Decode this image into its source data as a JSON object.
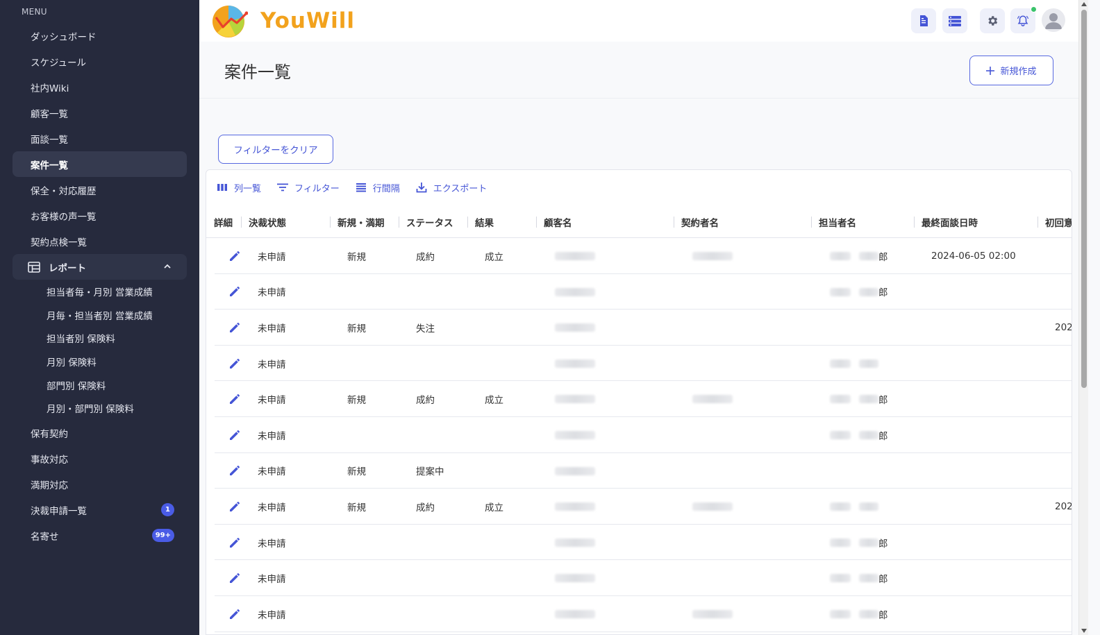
{
  "sidebar": {
    "heading": "MENU",
    "items": [
      {
        "label": "ダッシュボード"
      },
      {
        "label": "スケジュール"
      },
      {
        "label": "社内Wiki"
      },
      {
        "label": "顧客一覧"
      },
      {
        "label": "面談一覧"
      },
      {
        "label": "案件一覧",
        "active": true
      },
      {
        "label": "保全・対応履歴"
      },
      {
        "label": "お客様の声一覧"
      },
      {
        "label": "契約点検一覧"
      }
    ],
    "report_group": {
      "label": "レポート",
      "expanded": true,
      "sub_items": [
        {
          "label": "担当者毎・月別 営業成績"
        },
        {
          "label": "月毎・担当者別 営業成績"
        },
        {
          "label": "担当者別 保険料"
        },
        {
          "label": "月別 保険料"
        },
        {
          "label": "部門別 保険料"
        },
        {
          "label": "月別・部門別 保険料"
        }
      ]
    },
    "items_after": [
      {
        "label": "保有契約"
      },
      {
        "label": "事故対応"
      },
      {
        "label": "満期対応"
      },
      {
        "label": "決裁申請一覧",
        "badge": "1"
      },
      {
        "label": "名寄せ",
        "badge": "99+"
      }
    ]
  },
  "header": {
    "brand": "YouWill",
    "icons": [
      "document-icon",
      "list-icon",
      "gear-icon",
      "bell-icon",
      "user-icon"
    ]
  },
  "page": {
    "title": "案件一覧",
    "new_button": "新規作成",
    "clear_filter": "フィルターをクリア"
  },
  "toolbar": {
    "columns": "列一覧",
    "filter": "フィルター",
    "density": "行間隔",
    "export": "エクスポート"
  },
  "table": {
    "headers": {
      "detail": "詳細",
      "approval": "決裁状態",
      "type": "新規・満期",
      "status": "ステータス",
      "result": "結果",
      "customer": "顧客名",
      "contractor": "契約者名",
      "owner": "担当者名",
      "last_meeting": "最終面談日時",
      "first": "初回意"
    },
    "rows": [
      {
        "approval": "未申請",
        "type": "新規",
        "status": "成約",
        "result": "成立",
        "owner_tail": "郎",
        "last_meeting": "2024-06-05 02:00",
        "first": ""
      },
      {
        "approval": "未申請",
        "type": "",
        "status": "",
        "result": "",
        "owner_tail": "郎",
        "last_meeting": "",
        "first": ""
      },
      {
        "approval": "未申請",
        "type": "新規",
        "status": "失注",
        "result": "",
        "owner_tail": "",
        "last_meeting": "",
        "first": "202"
      },
      {
        "approval": "未申請",
        "type": "",
        "status": "",
        "result": "",
        "owner_tail": "",
        "last_meeting": "",
        "first": ""
      },
      {
        "approval": "未申請",
        "type": "新規",
        "status": "成約",
        "result": "成立",
        "owner_tail": "郎",
        "last_meeting": "",
        "first": ""
      },
      {
        "approval": "未申請",
        "type": "",
        "status": "",
        "result": "",
        "owner_tail": "郎",
        "last_meeting": "",
        "first": ""
      },
      {
        "approval": "未申請",
        "type": "新規",
        "status": "提案中",
        "result": "",
        "owner_tail": "",
        "last_meeting": "",
        "first": ""
      },
      {
        "approval": "未申請",
        "type": "新規",
        "status": "成約",
        "result": "成立",
        "owner_tail": "",
        "last_meeting": "",
        "first": "202"
      },
      {
        "approval": "未申請",
        "type": "",
        "status": "",
        "result": "",
        "owner_tail": "郎",
        "last_meeting": "",
        "first": ""
      },
      {
        "approval": "未申請",
        "type": "",
        "status": "",
        "result": "",
        "owner_tail": "郎",
        "last_meeting": "",
        "first": ""
      },
      {
        "approval": "未申請",
        "type": "",
        "status": "",
        "result": "",
        "owner_tail": "郎",
        "last_meeting": "",
        "first": ""
      }
    ]
  },
  "colors": {
    "sidebar_bg": "#262a3d",
    "accent": "#4555d6",
    "brand_orange": "#f2a21d",
    "notification": "#3ac36b"
  }
}
